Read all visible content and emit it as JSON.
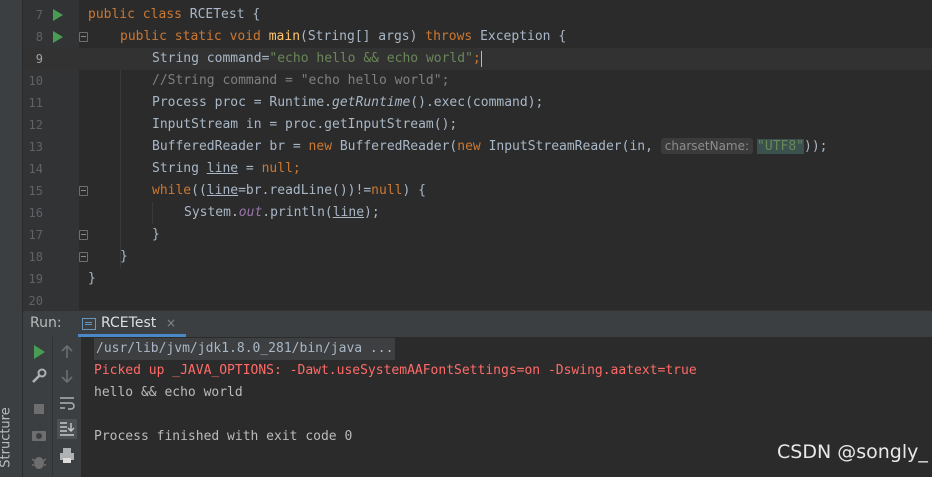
{
  "editor": {
    "lines": [
      {
        "num": "7",
        "has_run": true
      },
      {
        "num": "8",
        "has_run": true
      },
      {
        "num": "9",
        "current": true
      },
      {
        "num": "10"
      },
      {
        "num": "11"
      },
      {
        "num": "12"
      },
      {
        "num": "13"
      },
      {
        "num": "14"
      },
      {
        "num": "15"
      },
      {
        "num": "16"
      },
      {
        "num": "17"
      },
      {
        "num": "18"
      },
      {
        "num": "19"
      },
      {
        "num": "20"
      }
    ],
    "code": {
      "l7": {
        "kw1": "public class ",
        "name": "RCETest {"
      },
      "l8": {
        "kw1": "public static void ",
        "method": "main",
        "rest": "(String[] args) ",
        "kw2": "throws ",
        "rest2": "Exception {"
      },
      "l9": {
        "type": "String command=",
        "str": "\"echo hello && echo world\"",
        "end": ";"
      },
      "l10": {
        "comment": "//String command = \"echo hello world\";"
      },
      "l11": {
        "a": "Process proc = Runtime.",
        "b": "getRuntime",
        "c": "().exec(command);"
      },
      "l12": {
        "a": "InputStream in = proc.getInputStream();"
      },
      "l13": {
        "a": "BufferedReader br = ",
        "kw": "new ",
        "b": "BufferedReader(",
        "kw2": "new ",
        "c": "InputStreamReader(in, ",
        "hint": "charsetName:",
        "str": "\"UTF8\"",
        "d": "));"
      },
      "l14": {
        "a": "String ",
        "var": "line",
        "b": " = ",
        "kw": "null",
        "c": ";"
      },
      "l15": {
        "kw": "while",
        "a": "((",
        "var": "line",
        "b": "=br.readLine())!=",
        "kw2": "null",
        "c": ") {"
      },
      "l16": {
        "a": "System.",
        "fld": "out",
        "b": ".println(",
        "var": "line",
        "c": ");"
      },
      "l17": {
        "a": "}"
      },
      "l18": {
        "a": "}"
      },
      "l19": {
        "a": "}"
      }
    }
  },
  "run_panel": {
    "label": "Run:",
    "tab_name": "RCETest",
    "close_glyph": "×",
    "console": {
      "cmd": "/usr/lib/jvm/jdk1.8.0_281/bin/java ...",
      "warning": "Picked up _JAVA_OPTIONS: -Dawt.useSystemAAFontSettings=on -Dswing.aatext=true",
      "output": "hello && echo world",
      "exit": "Process finished with exit code 0"
    }
  },
  "sidebar": {
    "structure_label": "Structure"
  },
  "watermark": "CSDN @songly_",
  "colors": {
    "keyword": "#cc7832",
    "string": "#6a8759",
    "method": "#ffc66d",
    "error": "#ff6b68",
    "run": "#499c54"
  }
}
